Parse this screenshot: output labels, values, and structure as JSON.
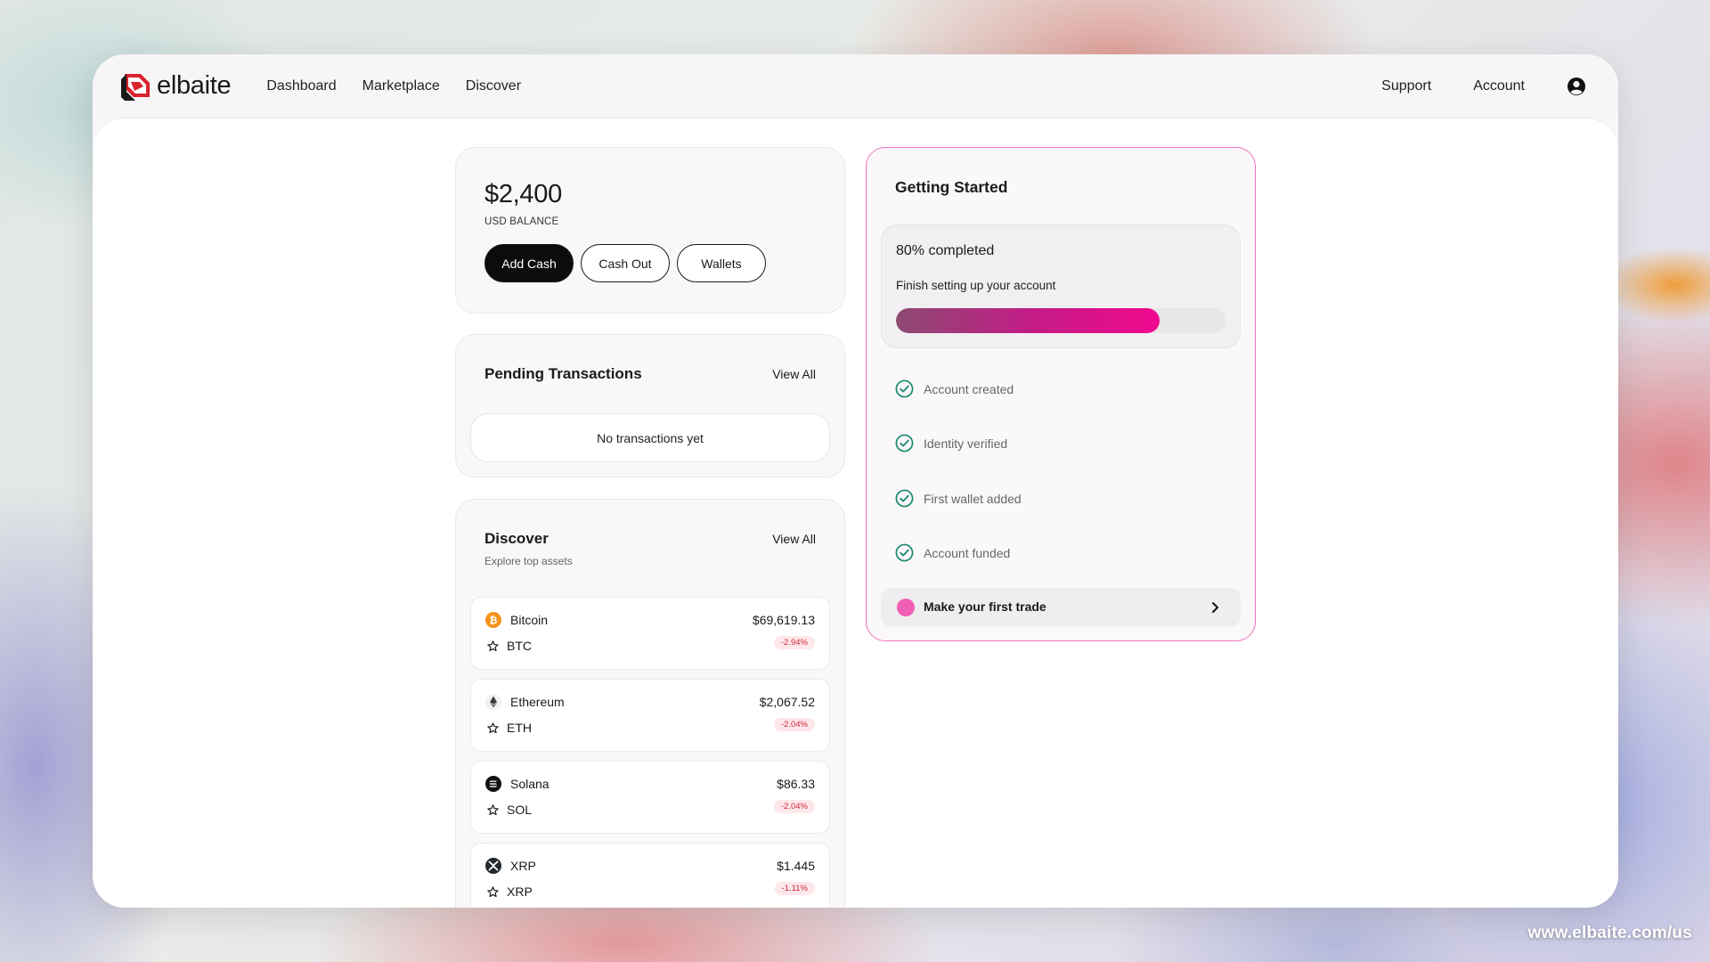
{
  "brand": {
    "name": "elbaite",
    "accent": "#d9232e"
  },
  "nav": {
    "items": [
      {
        "label": "Dashboard"
      },
      {
        "label": "Marketplace"
      },
      {
        "label": "Discover"
      }
    ],
    "support": "Support",
    "account": "Account",
    "account_icon": "user-circle-icon"
  },
  "balance": {
    "amount": "$2,400",
    "label": "USD BALANCE",
    "actions": {
      "add_cash": "Add Cash",
      "cash_out": "Cash Out",
      "wallets": "Wallets"
    }
  },
  "pending": {
    "title": "Pending Transactions",
    "view_all": "View All",
    "empty": "No transactions yet"
  },
  "discover": {
    "title": "Discover",
    "subtitle": "Explore top assets",
    "view_all": "View All",
    "assets": [
      {
        "name": "Bitcoin",
        "symbol": "BTC",
        "price": "$69,619.13",
        "change": "-2.94%",
        "icon": "bitcoin-icon",
        "color": "#f7931a"
      },
      {
        "name": "Ethereum",
        "symbol": "ETH",
        "price": "$2,067.52",
        "change": "-2.04%",
        "icon": "ethereum-icon",
        "color": "#3c3c3d"
      },
      {
        "name": "Solana",
        "symbol": "SOL",
        "price": "$86.33",
        "change": "-2.04%",
        "icon": "solana-icon",
        "color": "#111111"
      },
      {
        "name": "XRP",
        "symbol": "XRP",
        "price": "$1.445",
        "change": "-1.11%",
        "icon": "xrp-icon",
        "color": "#23292f"
      }
    ]
  },
  "getting_started": {
    "title": "Getting Started",
    "progress_text": "80% completed",
    "progress_value": 0.8,
    "description": "Finish setting up your account",
    "steps": [
      {
        "label": "Account created",
        "done": true
      },
      {
        "label": "Identity verified",
        "done": true
      },
      {
        "label": "First wallet added",
        "done": true
      },
      {
        "label": "Account funded",
        "done": true
      }
    ],
    "next_step": "Make your first trade",
    "accent": "#ec74b8",
    "check_color": "#1a8a6e"
  },
  "footer": {
    "url": "www.elbaite.com/us"
  }
}
